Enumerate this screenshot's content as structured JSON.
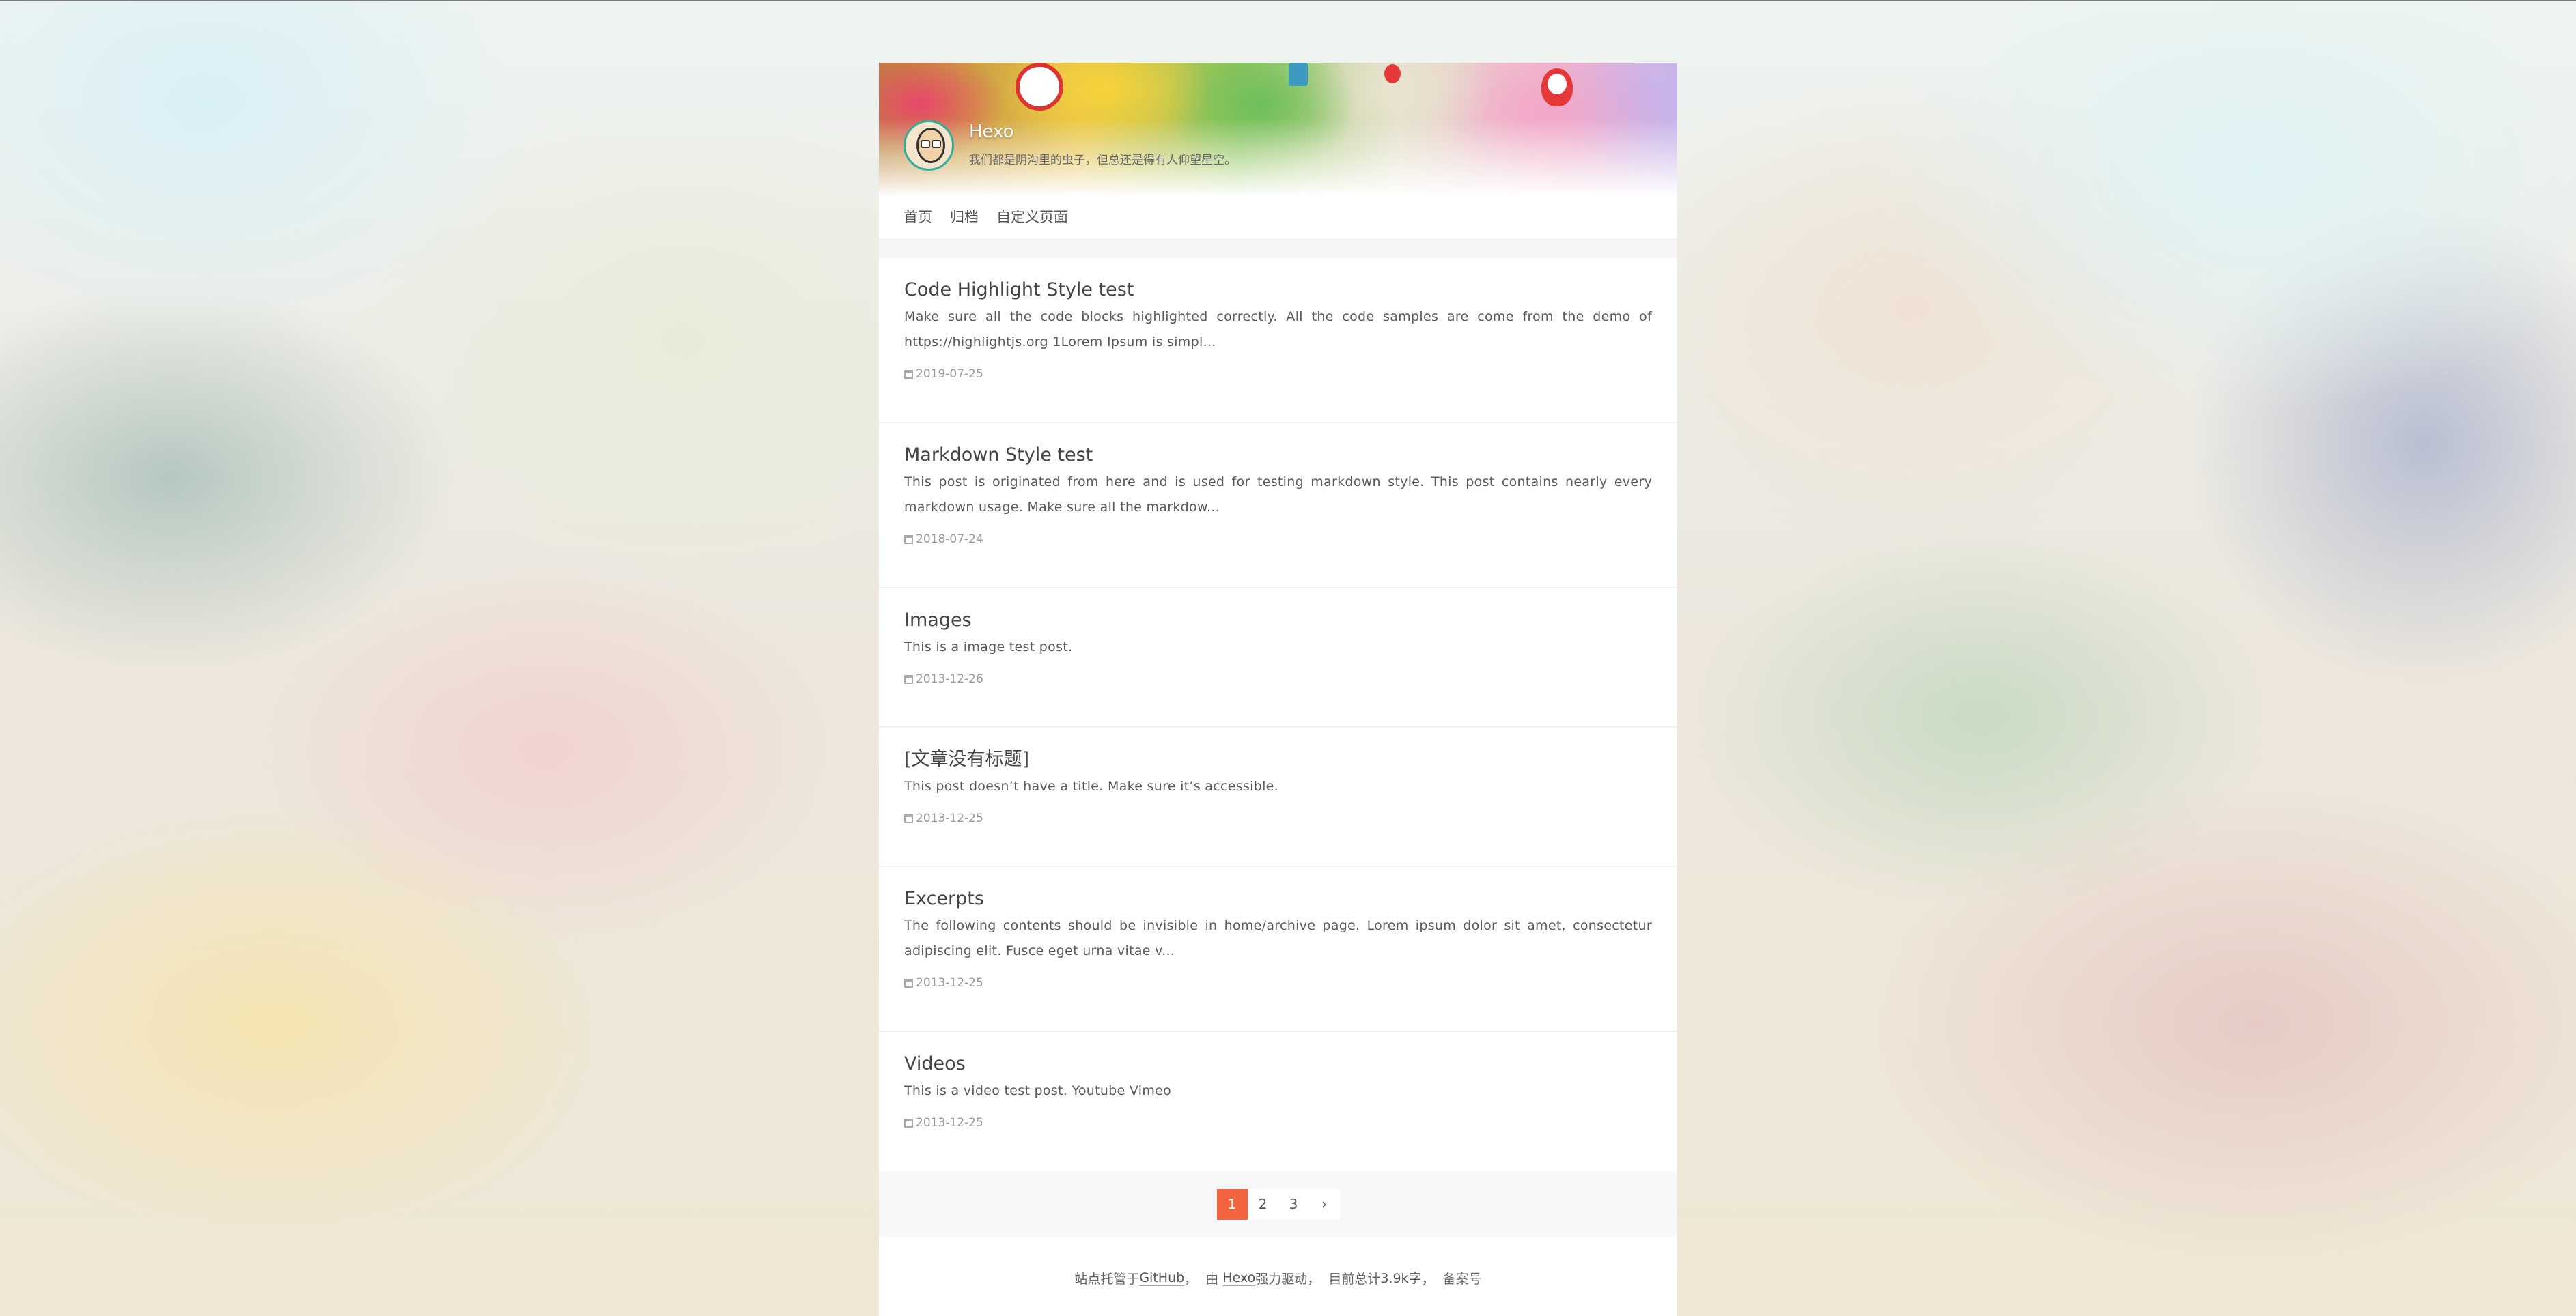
{
  "site": {
    "title": "Hexo",
    "subtitle": "我们都是阴沟里的虫子，但总还是得有人仰望星空。"
  },
  "nav": {
    "items": [
      {
        "label": "首页"
      },
      {
        "label": "归档"
      },
      {
        "label": "自定义页面"
      }
    ]
  },
  "posts": [
    {
      "title": "Code Highlight Style test",
      "excerpt": "Make sure all the code blocks highlighted correctly. All the code samples are come from the demo of https://highlightjs.org 1Lorem Ipsum is simpl...",
      "date": "2019-07-25"
    },
    {
      "title": "Markdown Style test",
      "excerpt": "This post is originated from here and is used for testing markdown style. This post contains nearly every markdown usage. Make sure all the markdow...",
      "date": "2018-07-24"
    },
    {
      "title": "Images",
      "excerpt": "This is a image test post.",
      "date": "2013-12-26"
    },
    {
      "title": "[文章没有标题]",
      "excerpt": "This post doesn’t have a title. Make sure it’s accessible.",
      "date": "2013-12-25"
    },
    {
      "title": "Excerpts",
      "excerpt": "The following contents should be invisible in home/archive page. Lorem ipsum dolor sit amet, consectetur adipiscing elit. Fusce eget urna vitae v...",
      "date": "2013-12-25"
    },
    {
      "title": "Videos",
      "excerpt": "This is a video test post. Youtube Vimeo",
      "date": "2013-12-25"
    }
  ],
  "pagination": {
    "pages": [
      "1",
      "2",
      "3"
    ],
    "next": "›",
    "current": "1",
    "accent_color": "#f4633f"
  },
  "footer": {
    "hosted_prefix": "站点托管于",
    "hosted_link": "GitHub",
    "powered_prefix": "，  由 ",
    "powered_link": "Hexo",
    "powered_suffix": "强力驱动，  目前总计",
    "word_count": "3.9k字",
    "separator": "，  ",
    "icp": "备案号"
  },
  "icons": {
    "calendar": "calendar-icon",
    "next_page": "chevron-right-icon"
  }
}
